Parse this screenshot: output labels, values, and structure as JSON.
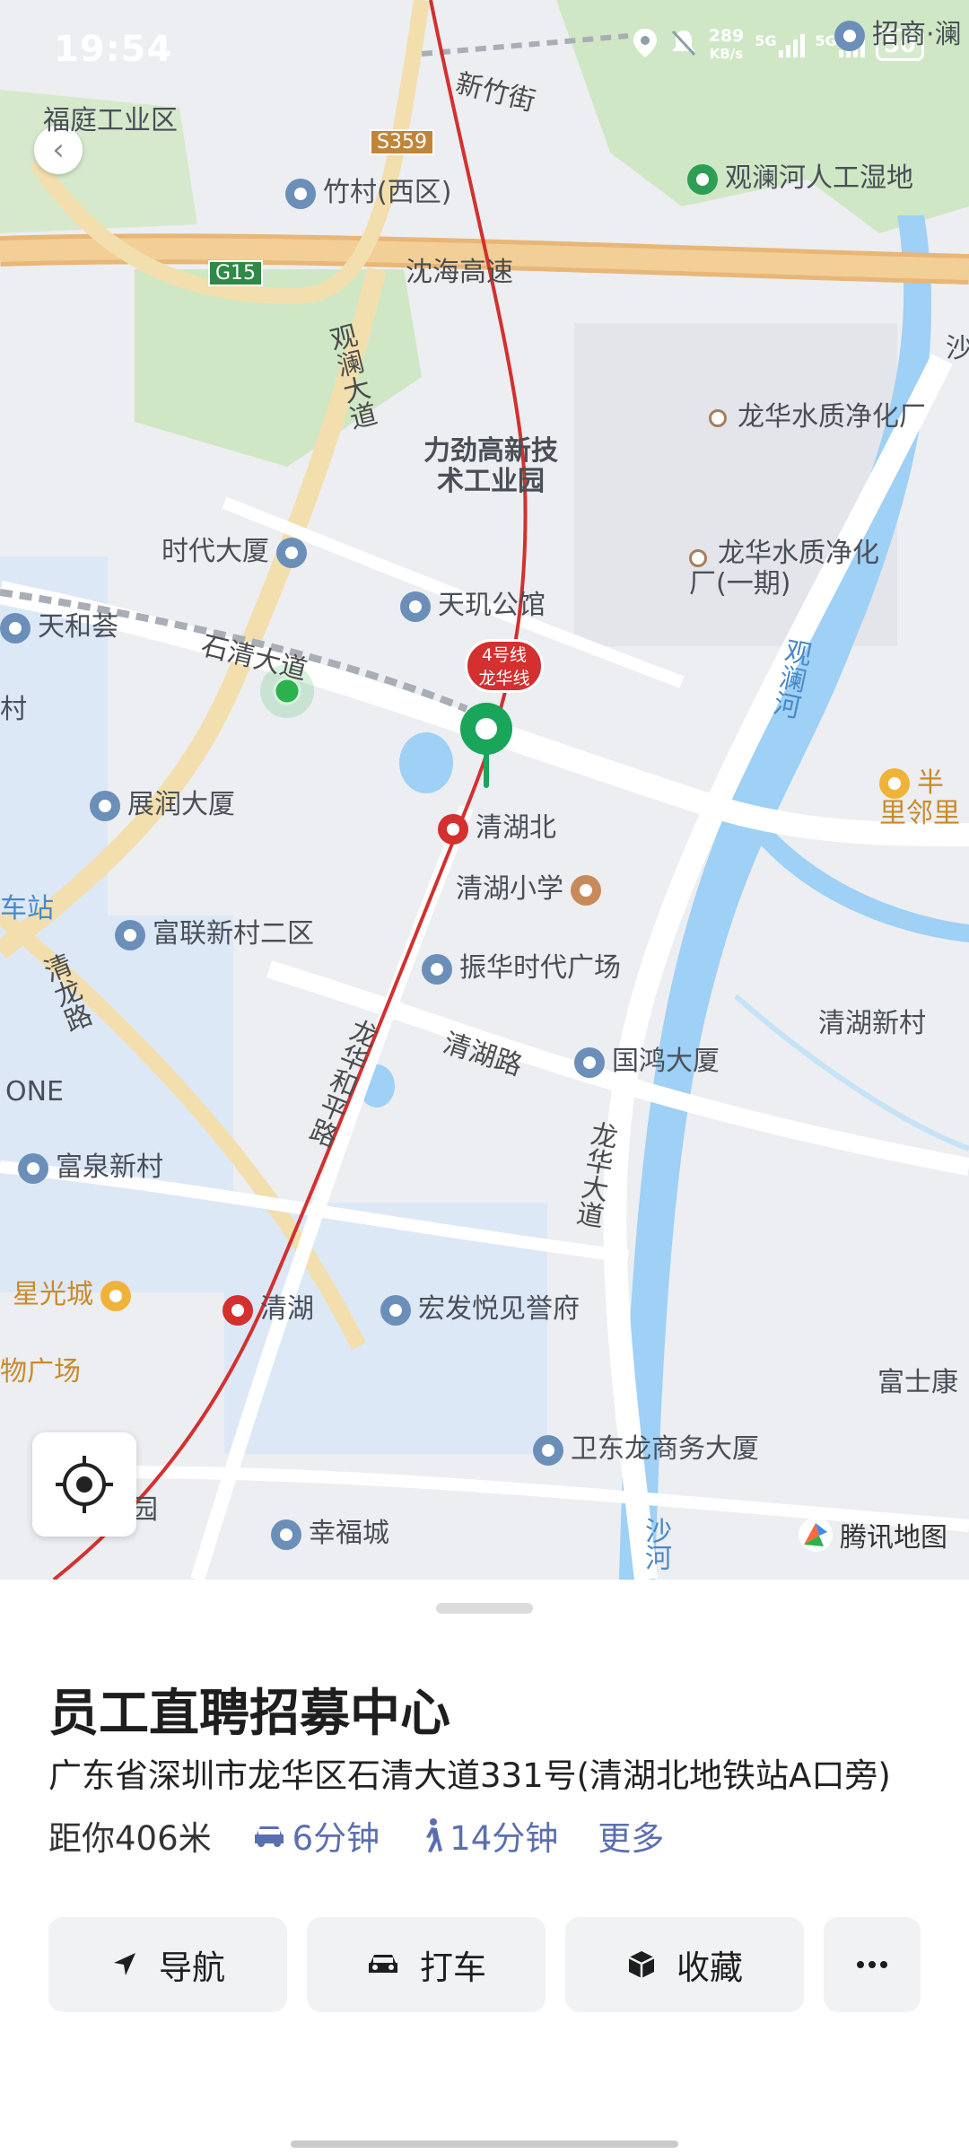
{
  "status_bar": {
    "time": "19:54",
    "net_speed": "289",
    "net_unit": "KB/s",
    "sim1": "5G",
    "sim2": "5G",
    "battery": "50"
  },
  "map": {
    "roads": {
      "xinzhu_street": "新竹街",
      "s359": "S359",
      "g15": "G15",
      "shenhai": "沈海高速",
      "guanlan_avenue": "观澜大道",
      "shiqing_avenue": "石清大道",
      "qinglong_road": "清龙路",
      "longhua_heping": "龙华和平路",
      "qinghu_road": "清湖路",
      "longhua_avenue": "龙华大道",
      "guanlan_river": "观澜河",
      "sha_river": "沙河"
    },
    "places": {
      "futing": "福庭工业区",
      "zhucun": "竹村(西区)",
      "wetland": "观澜河人工湿地",
      "zhaoshang": "招商·澜",
      "liquid": "力劲高新技术工业园",
      "plant1": "龙华水质净化厂",
      "plant2": "龙华水质净化厂(一期)",
      "shidai": "时代大厦",
      "tianji": "天玑公馆",
      "tianhe": "天和荟",
      "zhanrun": "展润大厦",
      "qinghubei": "清湖北",
      "qinghu_school": "清湖小学",
      "fulian": "富联新村二区",
      "zhenhua": "振华时代广场",
      "guohong": "国鸿大厦",
      "qinghu_village": "清湖新村",
      "one": "ONE",
      "fuquan": "富泉新村",
      "xingguang": "星光城",
      "qinghu_station": "清湖",
      "hongfa": "宏发悦见誉府",
      "fushikang": "富士康",
      "wudong": "卫东龙商务大厦",
      "xingfu": "幸福城",
      "banli": "半里邻里",
      "mall": "物广场",
      "station_frag": "车站",
      "sha_frag": "沙",
      "cun_frag": "村",
      "yuan_frag": "园"
    },
    "metro_badge": {
      "line": "4号线",
      "name": "龙华线"
    },
    "brand": "腾讯地图"
  },
  "place_card": {
    "title": "员工直聘招募中心",
    "address": "广东省深圳市龙华区石清大道331号(清湖北地铁站A口旁)",
    "distance": "距你406米",
    "drive_time": "6分钟",
    "walk_time": "14分钟",
    "more": "更多"
  },
  "actions": {
    "navigate": "导航",
    "taxi": "打车",
    "favorite": "收藏",
    "more_icon": "more-icon"
  },
  "colors": {
    "accent_green": "#19a55a",
    "metro_red": "#d3302f",
    "link_blue": "#5b6fb0",
    "water": "#9fd0f5",
    "park": "#cfe7c5"
  }
}
